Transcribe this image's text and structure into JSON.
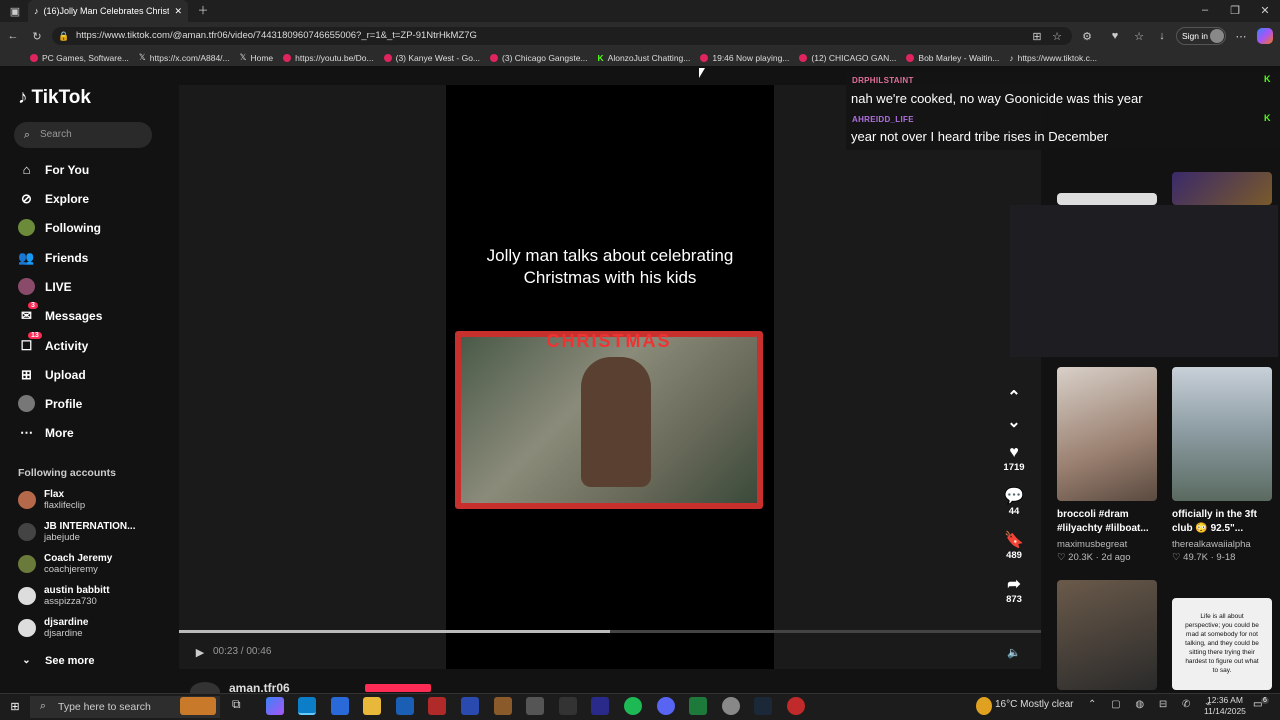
{
  "browser": {
    "tab_title": "(16)Jolly Man Celebrates Christm…",
    "url": "https://www.tiktok.com/@aman.tfr06/video/7443180960746655006?_r=1&_t=ZP-91NtrHkMZ7G",
    "sign_in": "Sign in",
    "bookmarks": [
      "PC Games, Software...",
      "https://x.com/A884/...",
      "Home",
      "https://youtu.be/Do...",
      "(3) Kanye West - Go...",
      "(3) Chicago Gangste...",
      "AlonzoJust Chatting...",
      "19:46 Now playing...",
      "(12) CHICAGO GAN...",
      "Bob Marley - Waitin...",
      "https://www.tiktok.c..."
    ]
  },
  "sidebar": {
    "brand": "TikTok",
    "search_placeholder": "Search",
    "nav": [
      {
        "label": "For You",
        "icon": "home-icon"
      },
      {
        "label": "Explore",
        "icon": "compass-icon"
      },
      {
        "label": "Following",
        "icon": "following-icon"
      },
      {
        "label": "Friends",
        "icon": "friends-icon"
      },
      {
        "label": "LIVE",
        "icon": "live-icon"
      },
      {
        "label": "Messages",
        "icon": "messages-icon",
        "badge": "3"
      },
      {
        "label": "Activity",
        "icon": "activity-icon",
        "badge": "13"
      },
      {
        "label": "Upload",
        "icon": "upload-icon"
      },
      {
        "label": "Profile",
        "icon": "profile-icon"
      },
      {
        "label": "More",
        "icon": "more-icon"
      }
    ],
    "following_heading": "Following accounts",
    "following": [
      {
        "name": "Flax",
        "user": "flaxlifeclip"
      },
      {
        "name": "JB INTERNATION...",
        "user": "jabejude"
      },
      {
        "name": "Coach Jeremy",
        "user": "coachjeremy"
      },
      {
        "name": "austin babbitt",
        "user": "asspizza730"
      },
      {
        "name": "djsardine",
        "user": "djsardine"
      }
    ],
    "see_more": "See more"
  },
  "video": {
    "caption": "Jolly man talks about celebrating Christmas with his kids",
    "banner": "CHRISTMAS",
    "time": "00:23 / 00:46",
    "progress": 0.5,
    "author": "aman.tfr06"
  },
  "actions": {
    "likes": "1719",
    "comments": "44",
    "saves": "489",
    "shares": "873"
  },
  "chat": [
    {
      "user": "DRPHILSTAINT",
      "message": "nah we're cooked, no way Goonicide was this year",
      "color": "#e0709a"
    },
    {
      "user": "AHREIDD_LIFE",
      "message": "year not over I heard tribe rises in December",
      "color": "#b070e0"
    }
  ],
  "recommended": [
    {
      "title": "broccoli #dram #lilyachty #lilboat...",
      "author": "maximusbegreat",
      "stats": "♡ 20.3K · 2d ago"
    },
    {
      "title": "officially in the 3ft club 😳 92.5\"...",
      "author": "therealkawaiialpha",
      "stats": "♡ 49.7K · 9-18"
    }
  ],
  "quote_thumb": "Life is all about perspective; you could be mad at somebody for not talking, and they could be sitting there trying their hardest to figure out what to say.",
  "taskbar": {
    "search": "Type here to search",
    "weather": "16°C  Mostly clear",
    "time": "12:36 AM",
    "date": "11/14/2025",
    "notifications": "6"
  }
}
